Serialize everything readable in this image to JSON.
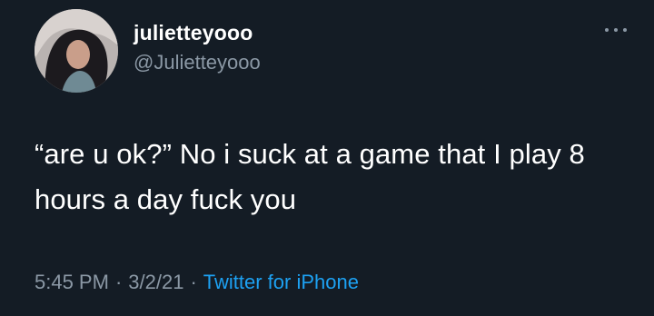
{
  "tweet": {
    "display_name": "julietteyooo",
    "handle": "@Julietteyooo",
    "text": "“are u ok?” No i suck at a game that I play 8 hours a day fuck you",
    "time": "5:45 PM",
    "date": "3/2/21",
    "source": "Twitter for iPhone",
    "separator": "·"
  },
  "icons": {
    "more": "more-options-icon",
    "avatar": "profile-avatar"
  },
  "colors": {
    "background": "#141c25",
    "secondary_text": "#8b98a5",
    "link": "#1da1f2"
  }
}
